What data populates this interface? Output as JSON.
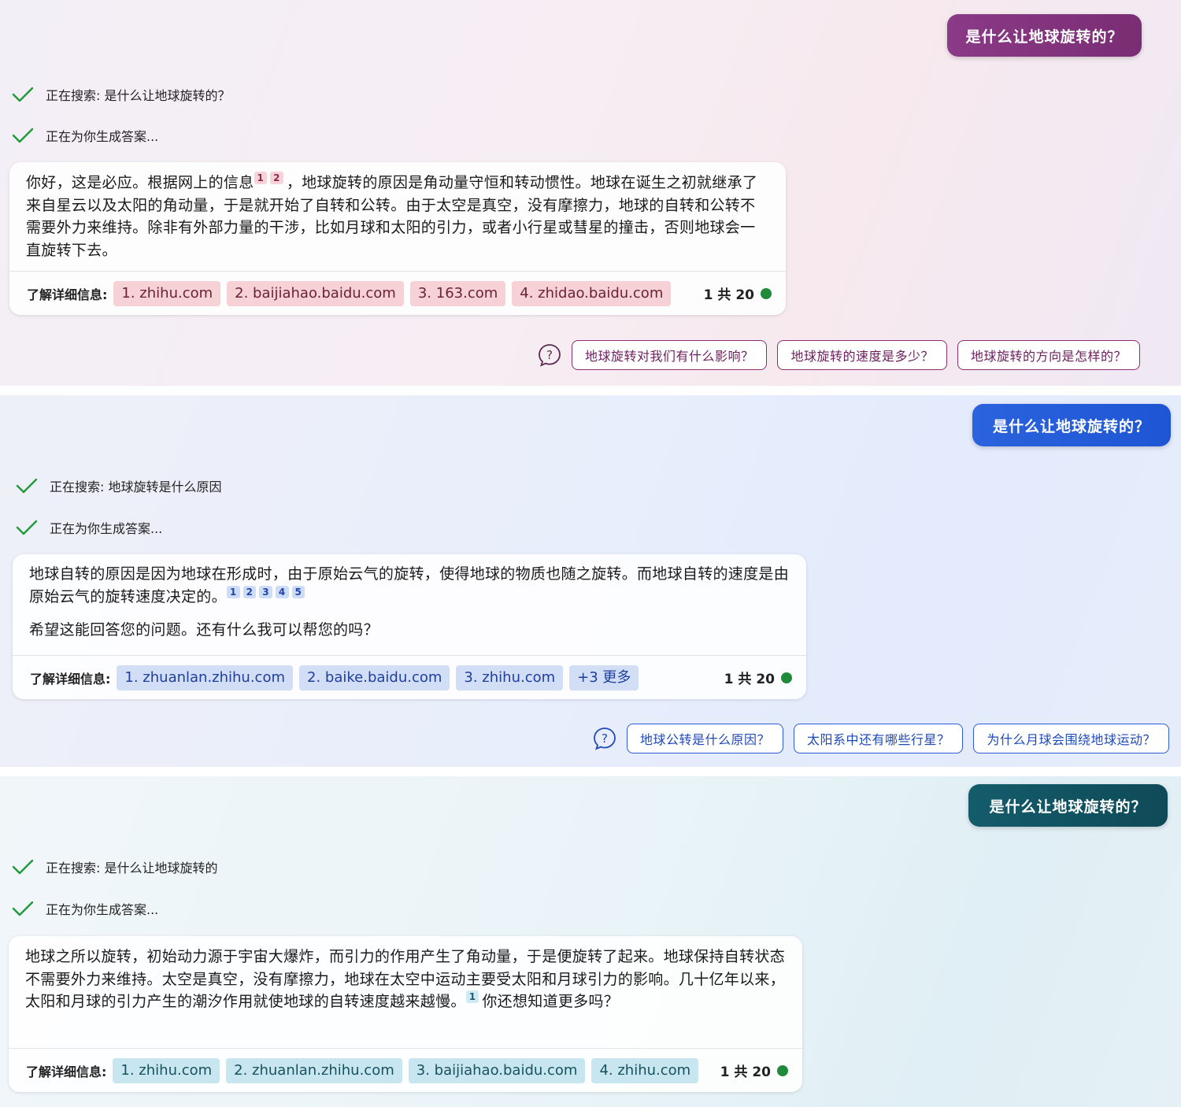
{
  "panels": [
    {
      "user_query": "是什么让地球旋转的？",
      "status": [
        "正在搜索: 是什么让地球旋转的？",
        "正在为你生成答案..."
      ],
      "answer_parts": {
        "intro": "你好，这是必应。根据网上的信息",
        "rest": "，地球旋转的原因是角动量守恒和转动惯性。地球在诞生之初就继承了来自星云以及太阳的角动量，于是就开始了自转和公转。由于太空是真空，没有摩擦力，地球的自转和公转不需要外力来维持。除非有外部力量的干涉，比如月球和太阳的引力，或者小行星或彗星的撞击，否则地球会一直旋转下去。"
      },
      "citations": [
        "1",
        "2"
      ],
      "footer_label": "了解详细信息:",
      "sources": [
        "1. zhihu.com",
        "2. baijiahao.baidu.com",
        "3. 163.com",
        "4. zhidao.baidu.com"
      ],
      "page_count": "1 共 20",
      "suggestions": [
        "地球旋转对我们有什么影响？",
        "地球旋转的速度是多少？",
        "地球旋转的方向是怎样的？"
      ],
      "theme": {
        "accent": "#7a2d73",
        "source_bg": "#f6d1d6"
      }
    },
    {
      "user_query": "是什么让地球旋转的？",
      "status": [
        "正在搜索: 地球旋转是什么原因",
        "正在为你生成答案..."
      ],
      "answer_parts": {
        "p1": "地球自转的原因是因为地球在形成时，由于原始云气的旋转，使得地球的物质也随之旋转。而地球自转的速度是由原始云气的旋转速度决定的。",
        "p2": "希望这能回答您的问题。还有什么我可以帮您的吗？"
      },
      "citations": [
        "1",
        "2",
        "3",
        "4",
        "5"
      ],
      "footer_label": "了解详细信息:",
      "sources": [
        "1. zhuanlan.zhihu.com",
        "2. baike.baidu.com",
        "3. zhihu.com",
        "+3 更多"
      ],
      "page_count": "1 共 20",
      "suggestions": [
        "地球公转是什么原因？",
        "太阳系中还有哪些行星？",
        "为什么月球会围绕地球运动？"
      ],
      "theme": {
        "accent": "#1d55d4",
        "source_bg": "#d2def6"
      }
    },
    {
      "user_query": "是什么让地球旋转的？",
      "status": [
        "正在搜索: 是什么让地球旋转的",
        "正在为你生成答案..."
      ],
      "answer_parts": {
        "main": "地球之所以旋转，初始动力源于宇宙大爆炸，而引力的作用产生了角动量，于是便旋转了起来。地球保持自转状态不需要外力来维持。太空是真空，没有摩擦力，地球在太空中运动主要受太阳和月球引力的影响。几十亿年以来，太阳和月球的引力产生的潮汐作用就使地球的自转速度越来越慢。",
        "tail": "你还想知道更多吗？"
      },
      "citations": [
        "1"
      ],
      "footer_label": "了解详细信息:",
      "sources": [
        "1. zhihu.com",
        "2. zhuanlan.zhihu.com",
        "3. baijiahao.baidu.com",
        "4. zhihu.com"
      ],
      "page_count": "1 共 20",
      "theme": {
        "accent": "#0f4a58",
        "source_bg": "#c8e6ef"
      }
    }
  ]
}
